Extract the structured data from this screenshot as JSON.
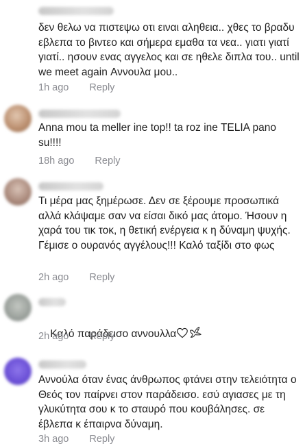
{
  "comments": [
    {
      "text": "δεν θελω να πιστεψω οτι ειναι αληθεια.. χθες το βραδυ εβλεπα το βιντεο και σήμερα εμαθα τα νεα.. γιατι γιατί γιατί.. ησουν ενας αγγελος και σε ηθελε διπλα του.. until we meet again Αννουλα μου..",
      "time": "1h ago",
      "reply": "Reply",
      "avatar_color": "#f0f0f0"
    },
    {
      "text": "Anna mou ta meller ine top!! ta roz ine TELIA pano su!!!!",
      "time": "18h ago",
      "reply": "Reply",
      "avatar_color": "#c9a488"
    },
    {
      "text": "Τι μέρα μας ξημέρωσε. Δεν σε ξέρουμε προσωπικά αλλά κλάψαμε σαν να είσαι δικό μας άτομο. Ήσουν η χαρά του τικ τοκ, η θετική ενέργεια κ η δύναμη ψυχής. Γέμισε ο ουρανός αγγέλους!!! Καλό ταξίδι στο φως",
      "time": "2h ago",
      "reply": "Reply",
      "avatar_color": "#b59a8f"
    },
    {
      "text": "Καλό παράδεισο αννουλλα",
      "time": "2h ago",
      "reply": "Reply",
      "avatar_color": "#a3a7a4"
    },
    {
      "text": "Αννούλα όταν ένας άνθρωπος φτάνει στην τελειότητα ο Θεός τον παίρνει στον παράδεισο. εσύ αγιασες με τη γλυκύτητα σου κ το σταυρό που κουβάλησες. σε έβλεπα κ έπαιρνα δύναμη.",
      "time": "3h ago",
      "reply": "Reply",
      "avatar_color": "#6a4fd6"
    }
  ]
}
